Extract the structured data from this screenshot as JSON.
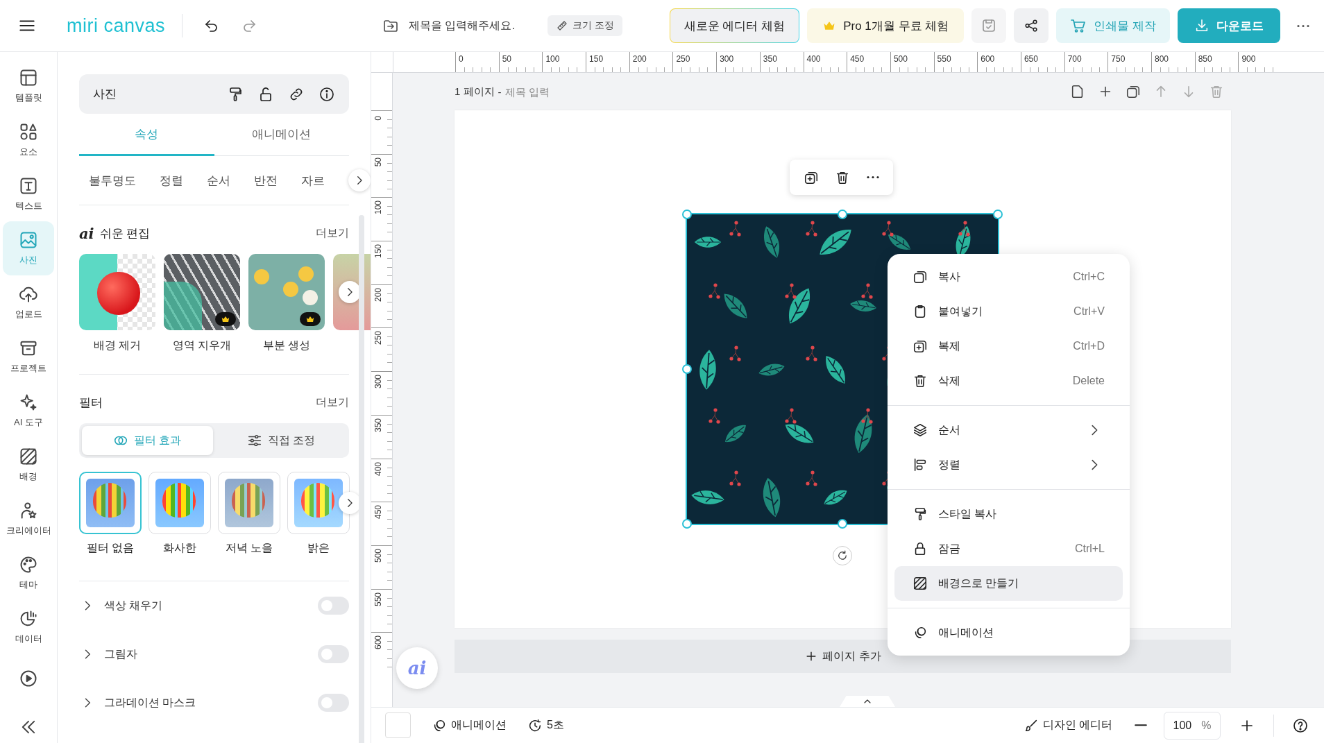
{
  "top_bar": {
    "logo": "miri canvas",
    "title_field": {
      "placeholder": "제목을 입력해주세요."
    },
    "resize_button": "크기 조정",
    "new_editor_button": "새로운 에디터 체험",
    "pro_trial_button": "Pro 1개월 무료 체험",
    "print_button": "인쇄물 제작",
    "download_button": "다운로드"
  },
  "sidebar": {
    "items": [
      {
        "label": "템플릿",
        "selected": false
      },
      {
        "label": "요소",
        "selected": false
      },
      {
        "label": "텍스트",
        "selected": false
      },
      {
        "label": "사진",
        "selected": true
      },
      {
        "label": "업로드",
        "selected": false
      },
      {
        "label": "프로젝트",
        "selected": false
      },
      {
        "label": "AI 도구",
        "selected": false
      },
      {
        "label": "배경",
        "selected": false
      },
      {
        "label": "크리에이터",
        "selected": false
      },
      {
        "label": "테마",
        "selected": false
      },
      {
        "label": "데이터",
        "selected": false
      }
    ]
  },
  "panel": {
    "title": "사진",
    "tabs": [
      {
        "label": "속성",
        "selected": true
      },
      {
        "label": "애니메이션",
        "selected": false
      }
    ],
    "property_tabs": [
      "불투명도",
      "정렬",
      "순서",
      "반전",
      "자르"
    ],
    "easy_edit": {
      "badge": "ai",
      "title": "쉬운 편집",
      "more": "더보기",
      "tools": [
        {
          "label": "배경 제거",
          "premium": false
        },
        {
          "label": "영역 지우개",
          "premium": true
        },
        {
          "label": "부분 생성",
          "premium": true
        }
      ]
    },
    "filter": {
      "title": "필터",
      "more": "더보기",
      "modes": [
        {
          "label": "필터 효과",
          "selected": true
        },
        {
          "label": "직접 조정",
          "selected": false
        }
      ],
      "options": [
        {
          "label": "필터 없음",
          "selected": true
        },
        {
          "label": "화사한",
          "selected": false
        },
        {
          "label": "저녁 노을",
          "selected": false
        },
        {
          "label": "밝은",
          "selected": false
        }
      ]
    },
    "settings": [
      {
        "label": "색상 채우기",
        "expanded": false,
        "on": false
      },
      {
        "label": "그림자",
        "expanded": false,
        "on": false
      },
      {
        "label": "그라데이션 마스크",
        "expanded": false,
        "on": false
      }
    ]
  },
  "canvas": {
    "h_ruler": [
      "0",
      "50",
      "100",
      "150",
      "200",
      "250",
      "300",
      "350",
      "400",
      "450",
      "500",
      "550",
      "600",
      "650",
      "700",
      "750",
      "800",
      "850",
      "900"
    ],
    "v_ruler": [
      "0",
      "50",
      "100",
      "150",
      "200",
      "250",
      "300",
      "350",
      "400",
      "450",
      "500",
      "550",
      "600"
    ],
    "page": {
      "label": "1 페이지",
      "separator": "-",
      "title_placeholder": "제목 입력"
    },
    "context_menu": [
      [
        {
          "label": "복사",
          "kind": "shortcut",
          "shortcut": "Ctrl+C",
          "highlighted": false
        },
        {
          "label": "붙여넣기",
          "kind": "shortcut",
          "shortcut": "Ctrl+V",
          "highlighted": false
        },
        {
          "label": "복제",
          "kind": "shortcut",
          "shortcut": "Ctrl+D",
          "highlighted": false
        },
        {
          "label": "삭제",
          "kind": "shortcut",
          "shortcut": "Delete",
          "highlighted": false
        }
      ],
      [
        {
          "label": "순서",
          "kind": "submenu",
          "highlighted": false
        },
        {
          "label": "정렬",
          "kind": "submenu",
          "highlighted": false
        }
      ],
      [
        {
          "label": "스타일 복사",
          "kind": "plain",
          "highlighted": false
        },
        {
          "label": "잠금",
          "kind": "shortcut",
          "shortcut": "Ctrl+L",
          "highlighted": false
        },
        {
          "label": "배경으로 만들기",
          "kind": "plain",
          "highlighted": true
        }
      ],
      [
        {
          "label": "애니메이션",
          "kind": "plain",
          "highlighted": false
        }
      ]
    ],
    "add_page_button": "페이지 추가",
    "ai_button": "ai"
  },
  "bottom_bar": {
    "animation_button": "애니메이션",
    "duration_button": "5초",
    "design_editor_button": "디자인 에디터",
    "zoom": {
      "value": "100",
      "unit": "%"
    }
  }
}
